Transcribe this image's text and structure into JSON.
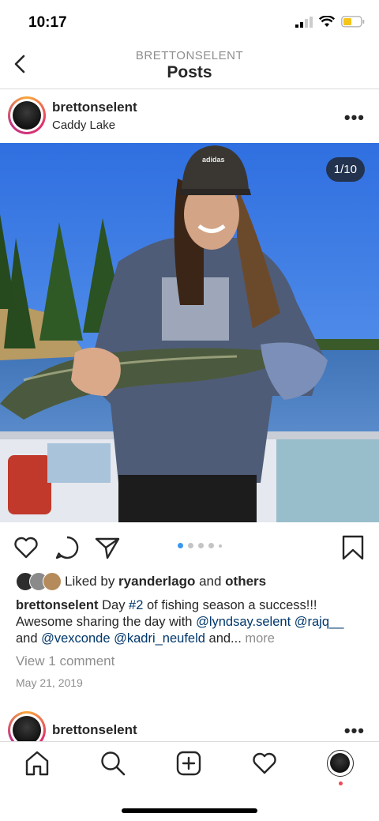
{
  "status_bar": {
    "time": "10:17"
  },
  "header": {
    "username": "BRETTONSELENT",
    "title": "Posts"
  },
  "post": {
    "username": "brettonselent",
    "location": "Caddy Lake",
    "more": "•••",
    "image_counter": "1/10",
    "cap_brand": "adidas",
    "likes": {
      "prefix": "Liked by ",
      "user": "ryanderlago",
      "middle": " and ",
      "others": "others"
    },
    "caption": {
      "user": "brettonselent",
      "t1": " Day ",
      "hashtag": "#2",
      "t2": " of fishing season a success!!! Awesome sharing the day with ",
      "m1": "@lyndsay.selent",
      "t3": " ",
      "m2": "@rajq__",
      "t4": " and ",
      "m3": "@vexconde",
      "t5": " ",
      "m4": "@kadri_neufeld",
      "t6": " and... ",
      "more": "more"
    },
    "view_comments": "View 1 comment",
    "date": "May 21, 2019"
  },
  "next_post": {
    "username": "brettonselent",
    "more": "•••"
  },
  "colors": {
    "link": "#00376b",
    "muted": "#8e8e8e",
    "dot_active": "#3897f0",
    "sky": "#3d78d8"
  }
}
